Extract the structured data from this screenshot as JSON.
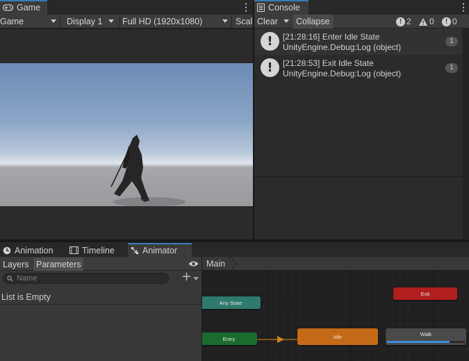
{
  "game": {
    "tab_label": "Game",
    "toolbar": {
      "mode": "Game",
      "display": "Display 1",
      "resolution": "Full HD (1920x1080)",
      "scale_label": "Scal"
    }
  },
  "console": {
    "tab_label": "Console",
    "clear_label": "Clear",
    "collapse_label": "Collapse",
    "counts": {
      "logs": "2",
      "warnings": "0",
      "errors": "0"
    },
    "entries": [
      {
        "line1": "[21:28:16] Enter Idle State",
        "line2": "UnityEngine.Debug:Log (object)",
        "count": "1"
      },
      {
        "line1": "[21:28:53] Exit Idle State",
        "line2": "UnityEngine.Debug:Log (object)",
        "count": "1"
      }
    ]
  },
  "bottom_tabs": {
    "animation": "Animation",
    "timeline": "Timeline",
    "animator": "Animator"
  },
  "animator": {
    "sub_tabs": {
      "layers": "Layers",
      "parameters": "Parameters"
    },
    "search_placeholder": "Name",
    "empty_message": "List is Empty",
    "breadcrumb": "Main",
    "states": {
      "any_state": "Any State",
      "entry": "Entry",
      "idle": "Idle",
      "walk": "Walk",
      "exit": "Exit"
    },
    "walk_progress": 0.8
  },
  "colors": {
    "accent": "#3a79bb",
    "any_state": "#2e7a6c",
    "entry": "#1b6b2f",
    "idle": "#c46a17",
    "walk": "#4a4a4a",
    "exit": "#b01e1e"
  }
}
